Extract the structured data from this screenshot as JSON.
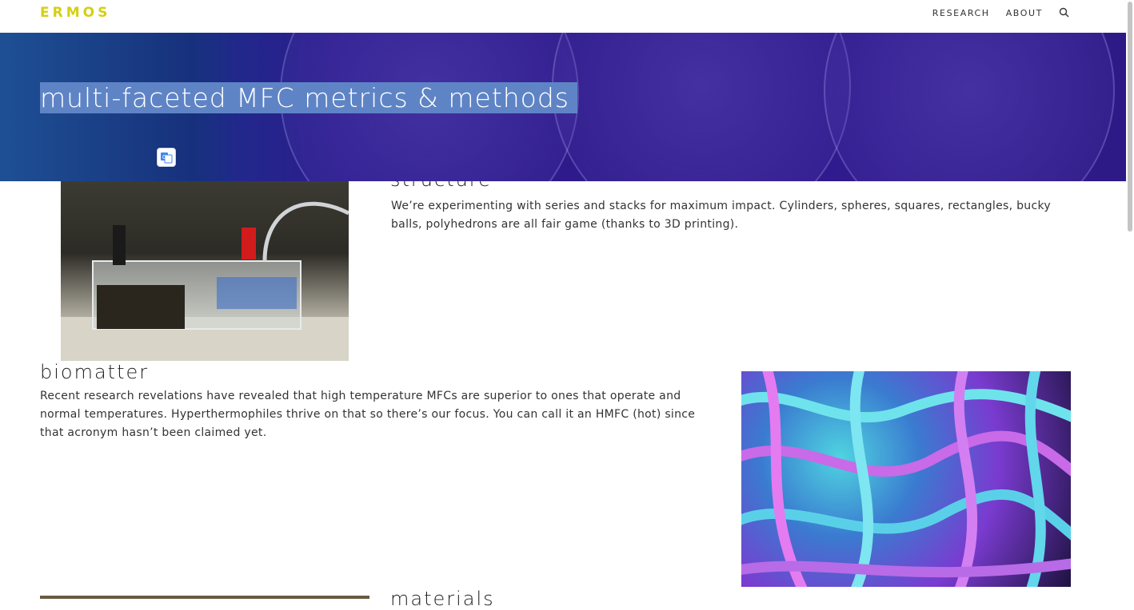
{
  "brand": {
    "logo": "ERMOS"
  },
  "nav": {
    "items": [
      "RESEARCH",
      "ABOUT"
    ],
    "search_icon": "search-icon"
  },
  "hero": {
    "title": "multi-faceted MFC metrics & methods"
  },
  "sections": [
    {
      "heading": "structure",
      "text": "We’re experimenting with series and stacks for maximum impact. Cylinders, spheres, squares, rectangles, bucky balls, polyhedrons are all fair game (thanks to 3D printing)."
    },
    {
      "heading": "biomatter",
      "text": "Recent research revelations have revealed that high temperature MFCs are superior to ones that operate and normal temperatures. Hyperthermophiles thrive on that so there’s our focus. You can call it an HMFC (hot) since that acronym hasn’t been claimed yet."
    },
    {
      "heading": "materials"
    }
  ],
  "colors": {
    "accent": "#d4cf13",
    "hero_bg": "#2e1a8a",
    "selection": "#5f84c6"
  }
}
